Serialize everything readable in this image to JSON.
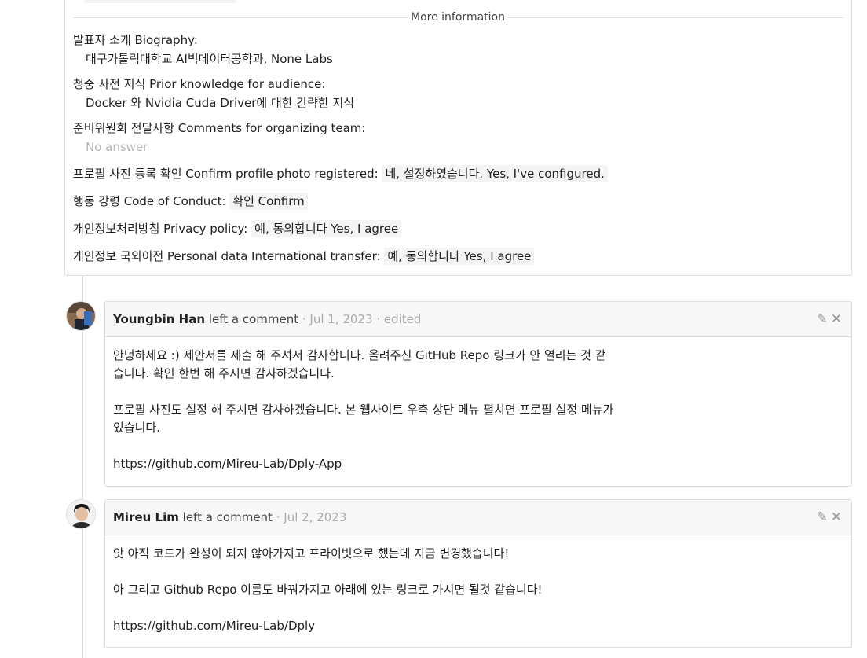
{
  "info": {
    "divider_label": "More information",
    "fields": [
      {
        "q": "발표자 소개 Biography:",
        "a": "대구가톨릭대학교 AI빅데이터공학과, None Labs"
      },
      {
        "q": "청중 사전 지식 Prior knowledge for audience:",
        "a": "Docker 와 Nvidia Cuda Driver에 대한 간략한 지식"
      },
      {
        "q": "준비위원회 전달사항 Comments for organizing team:",
        "a": "No answer"
      }
    ],
    "inline": [
      {
        "q": "프로필 사진 등록 확인 Confirm profile photo registered:",
        "a": "네, 설정하였습니다. Yes, I've configured."
      },
      {
        "q": "행동 강령 Code of Conduct:",
        "a": "확인 Confirm"
      },
      {
        "q": "개인정보처리방침 Privacy policy:",
        "a": "예, 동의합니다 Yes, I agree"
      },
      {
        "q": "개인정보 국외이전 Personal data International transfer:",
        "a": "예, 동의합니다 Yes, I agree"
      }
    ]
  },
  "comments": [
    {
      "author": "Youngbin Han",
      "verb": "left a comment",
      "meta": "· Jul 1, 2023 · edited",
      "body": [
        "안녕하세요 :) 제안서를 제출 해 주셔서 감사합니다. 올려주신 GitHub Repo 링크가 안 열리는 것 같습니다. 확인 한번 해 주시면 감사하겠습니다.",
        "프로필 사진도 설정 해 주시면 감사하겠습니다. 본 웹사이트 우측 상단 메뉴 펼치면 프로필 설정 메뉴가 있습니다.",
        "https://github.com/Mireu-Lab/Dply-App"
      ]
    },
    {
      "author": "Mireu Lim",
      "verb": "left a comment",
      "meta": "· Jul 2, 2023",
      "body": [
        "앗 아직 코드가 완성이 되지 않아가지고 프라이빗으로 했는데 지금 변경했습니다!",
        "아 그리고 Github Repo 이름도 바꿔가지고 아래에 있는 링크로 가시면 될것 같습니다!",
        "https://github.com/Mireu-Lab/Dply"
      ]
    }
  ],
  "icons": {
    "edit": "edit-icon",
    "delete": "close-icon"
  },
  "colors": {
    "border": "#dddddd",
    "muted": "#aaaaaa",
    "chip": "#f4f4f4"
  }
}
